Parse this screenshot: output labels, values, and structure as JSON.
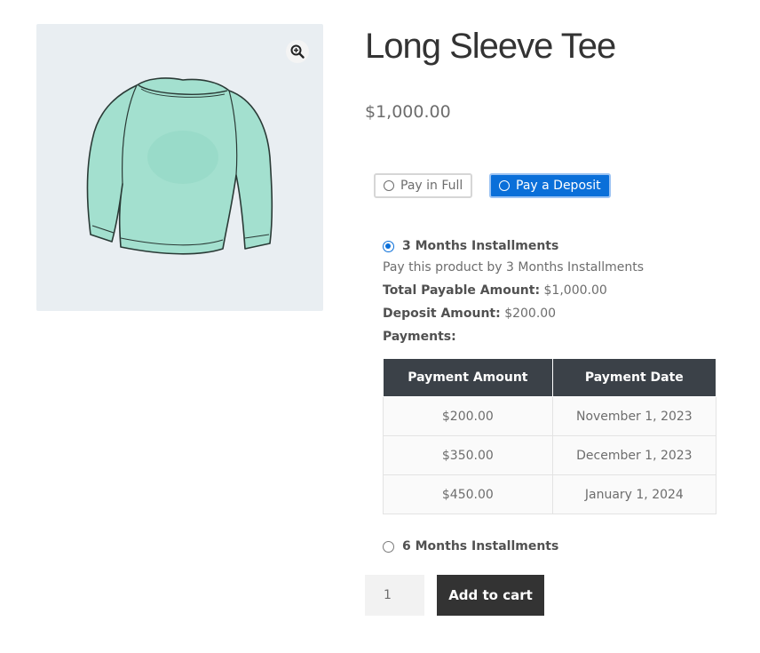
{
  "product": {
    "title": "Long Sleeve Tee",
    "price": "$1,000.00",
    "image_icon": "long-sleeve-shirt",
    "zoom_icon": "magnifier-plus-icon"
  },
  "payment_options": {
    "pay_in_full": "Pay in Full",
    "pay_deposit": "Pay a Deposit",
    "selected": "pay_deposit"
  },
  "plans": [
    {
      "label": "3 Months Installments",
      "selected": true,
      "description": "Pay this product by 3 Months Installments",
      "total_label": "Total Payable Amount:",
      "total_value": "$1,000.00",
      "deposit_label": "Deposit Amount:",
      "deposit_value": "$200.00",
      "payments_label": "Payments:"
    },
    {
      "label": "6 Months Installments",
      "selected": false
    }
  ],
  "payments_table": {
    "headers": [
      "Payment Amount",
      "Payment Date"
    ],
    "rows": [
      [
        "$200.00",
        "November 1, 2023"
      ],
      [
        "$350.00",
        "December 1, 2023"
      ],
      [
        "$450.00",
        "January 1, 2024"
      ]
    ]
  },
  "cart": {
    "quantity": "1",
    "add_to_cart": "Add to cart"
  },
  "colors": {
    "accent": "#0a6fd9",
    "table_header": "#3b4148",
    "button_dark": "#333333",
    "image_bg": "#e9eef2",
    "shirt": "#a3e0cf"
  }
}
